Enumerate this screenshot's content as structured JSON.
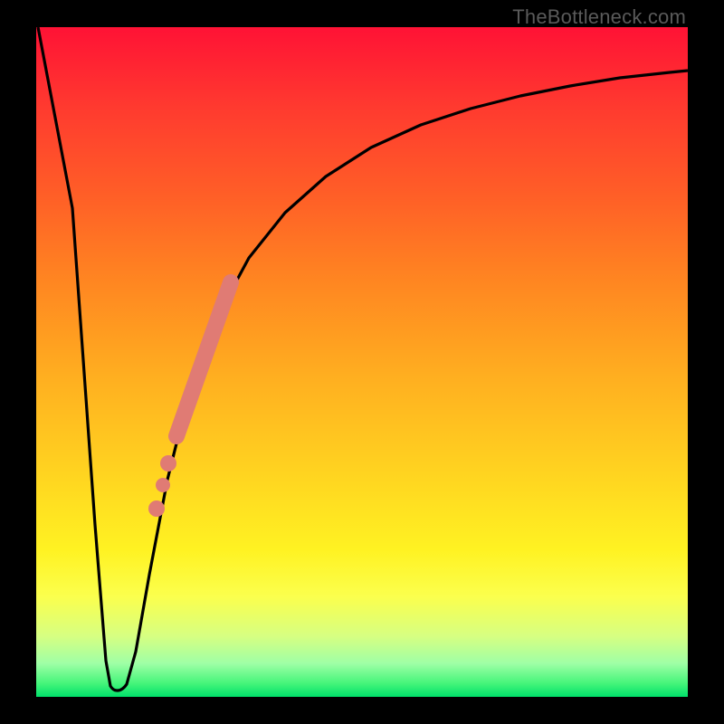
{
  "watermark": "TheBottleneck.com",
  "chart_data": {
    "type": "line",
    "title": "",
    "xlabel": "",
    "ylabel": "",
    "xlim": [
      0,
      100
    ],
    "ylim": [
      0,
      100
    ],
    "grid": false,
    "legend": false,
    "series": [
      {
        "name": "bottleneck-curve",
        "color": "#000000",
        "x": [
          0,
          4,
          8,
          10,
          11,
          12,
          14,
          16,
          18,
          20,
          22,
          25,
          28,
          32,
          36,
          40,
          45,
          50,
          55,
          60,
          65,
          70,
          75,
          80,
          85,
          90,
          95,
          100
        ],
        "y": [
          100,
          70,
          25,
          5,
          2,
          2,
          5,
          15,
          27,
          38,
          46,
          55,
          62,
          69,
          74,
          78,
          82,
          85,
          87.5,
          89.5,
          91,
          92.3,
          93.3,
          94.1,
          94.8,
          95.4,
          95.8,
          96.1
        ]
      },
      {
        "name": "highlight-segment",
        "color": "#e07b74",
        "style": "thick",
        "x": [
          19,
          20,
          21,
          22,
          23,
          24,
          25,
          26,
          27
        ],
        "y": [
          35,
          38,
          42,
          46,
          49,
          52,
          55,
          58,
          60
        ]
      },
      {
        "name": "highlight-dots",
        "color": "#e07b74",
        "style": "dots",
        "x": [
          17.5,
          18.3,
          19.0
        ],
        "y": [
          26,
          30,
          34
        ]
      }
    ]
  }
}
